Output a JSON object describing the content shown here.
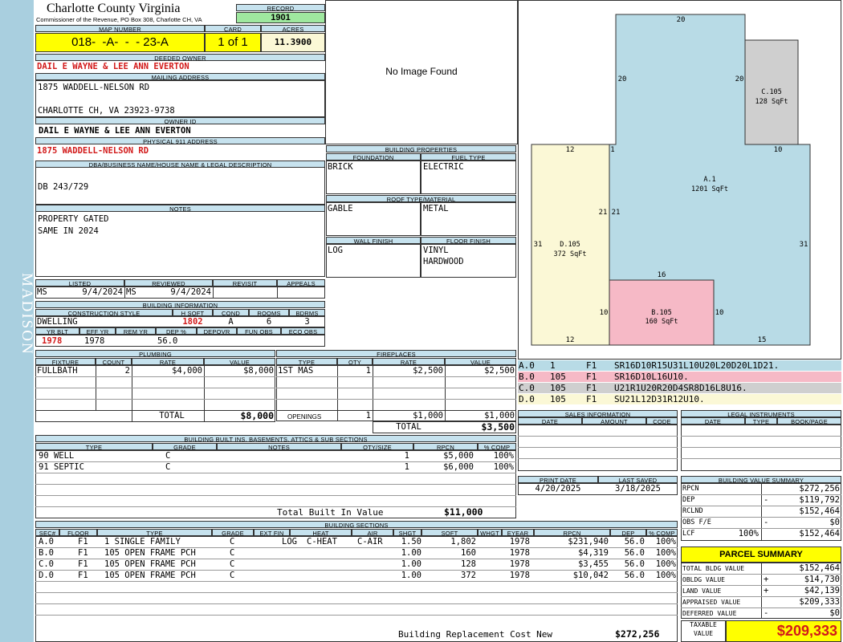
{
  "sidebar": {
    "label": "MADISON"
  },
  "header": {
    "county": "Charlotte County Virginia",
    "subtitle": "Commissioner of the Revenue, PO Box 308, Charlotte CH, VA",
    "record_label": "RECORD",
    "record": "1901"
  },
  "map": {
    "label": "MAP NUMBER",
    "value": "018-  -A-  -  - 23-A",
    "card_label": "CARD",
    "card": "1 of 1",
    "acres_label": "ACRES",
    "acres": "11.3900"
  },
  "owner": {
    "deeded_label": "DEEDED OWNER",
    "deeded": "DAIL E WAYNE & LEE ANN EVERTON",
    "mailing_label": "MAILING ADDRESS",
    "mail1": "1875 WADDELL-NELSON RD",
    "mail2": "CHARLOTTE CH, VA 23923-9738",
    "ownerid_label": "OWNER ID",
    "ownerid": "DAIL E WAYNE & LEE ANN EVERTON",
    "phys_label": "PHYSICAL 911 ADDRESS",
    "phys": "1875 WADDELL-NELSON RD"
  },
  "dba": {
    "label": "DBA/BUSINESS NAME/HOUSE NAME & LEGAL DESCRIPTION",
    "value": "DB 243/729"
  },
  "notes": {
    "label": "NOTES",
    "line1": "PROPERTY GATED",
    "line2": "SAME IN 2024"
  },
  "photo": {
    "text": "No Image Found"
  },
  "listed": {
    "listed_label": "LISTED",
    "reviewed_label": "REVIEWED",
    "revisit_label": "REVISIT",
    "appeals_label": "APPEALS",
    "listed_by": "MS",
    "listed_date": "9/4/2024",
    "reviewed_by": "MS",
    "reviewed_date": "9/4/2024"
  },
  "building_info": {
    "label": "BUILDING INFORMATION",
    "h_style": "CONSTRUCTION STYLE",
    "h_sqft": "H SQFT",
    "h_cond": "COND",
    "h_rooms": "ROOMS",
    "h_bdrms": "BDRMS",
    "style": "DWELLING",
    "sqft": "1802",
    "cond": "A",
    "rooms": "6",
    "bdrms": "3",
    "h_yrblt": "YR BLT",
    "h_effyr": "EFF YR",
    "h_remyr": "REM YR",
    "h_dep": "DEP %",
    "h_depovr": "DEPOVR",
    "h_funobs": "FUN OBS",
    "h_ecoobs": "ECO OBS",
    "yrblt": "1978",
    "effyr": "1978",
    "dep": "56.0"
  },
  "building_props": {
    "label": "BUILDING PROPERTIES",
    "foundation_label": "FOUNDATION",
    "fuel_label": "FUEL TYPE",
    "foundation": "BRICK",
    "fuel": "ELECTRIC",
    "roof_label": "ROOF TYPE/MATERIAL",
    "roof_type": "GABLE",
    "roof_mat": "METAL",
    "wall_label": "WALL FINISH",
    "floor_label": "FLOOR FINISH",
    "wall": "LOG",
    "floor1": "VINYL",
    "floor2": "HARDWOOD"
  },
  "plumbing": {
    "label": "PLUMBING",
    "h_fixture": "FIXTURE",
    "h_count": "COUNT",
    "h_rate": "RATE",
    "h_value": "VALUE",
    "rows": [
      {
        "fixture": "FULLBATH",
        "count": "2",
        "rate": "$4,000",
        "value": "$8,000"
      }
    ],
    "total_label": "TOTAL",
    "total": "$8,000"
  },
  "fireplaces": {
    "label": "FIREPLACES",
    "h_type": "TYPE",
    "h_qty": "QTY",
    "h_rate": "RATE",
    "h_value": "VALUE",
    "rows": [
      {
        "type": "1ST MAS",
        "qty": "1",
        "rate": "$2,500",
        "value": "$2,500"
      }
    ],
    "openings_label": "OPENINGS",
    "openings_qty": "1",
    "openings_rate": "$1,000",
    "openings_value": "$1,000",
    "total_label": "TOTAL",
    "total": "$3,500"
  },
  "sketch": {
    "lines": [
      {
        "code": "A.0",
        "n": "1",
        "f": "F1",
        "cmd": "SR16D10R15U31L10U20L20D20L1D21.",
        "color": "#b8dbe6"
      },
      {
        "code": "B.0",
        "n": "105",
        "f": "F1",
        "cmd": "SR16D10L16U10.",
        "color": "#f6b9c6"
      },
      {
        "code": "C.0",
        "n": "105",
        "f": "F1",
        "cmd": "U21R1U20R20D4SR8D16L8U16.",
        "color": "#cfcfcf"
      },
      {
        "code": "D.0",
        "n": "105",
        "f": "F1",
        "cmd": "SU21L12D31R12U10.",
        "color": "#fbf8d6"
      }
    ],
    "areas": {
      "a_label": "A.1",
      "a_sqft": "1201 SqFt",
      "b_label": "B.105",
      "b_sqft": "160 SqFt",
      "c_label": "C.105",
      "c_sqft": "128 SqFt",
      "d_label": "D.105",
      "d_sqft": "372 SqFt"
    },
    "dims": {
      "d20top": "20",
      "d20l": "20",
      "d20r": "20",
      "d12": "12",
      "d1": "1",
      "d10": "10",
      "d21a": "21",
      "d21b": "21",
      "d31l": "31",
      "d31r": "31",
      "d16": "16",
      "d10b": "10",
      "d10c": "10",
      "d12b": "12",
      "d15": "15"
    }
  },
  "sales": {
    "label": "SALES INFORMATION",
    "h_date": "DATE",
    "h_amount": "AMOUNT",
    "h_code": "CODE"
  },
  "legal": {
    "label": "LEGAL INSTRUMENTS",
    "h_date": "DATE",
    "h_type": "TYPE",
    "h_book": "BOOK/PAGE"
  },
  "dates": {
    "print_label": "PRINT DATE",
    "saved_label": "LAST SAVED",
    "print": "4/20/2025",
    "saved": "3/18/2025"
  },
  "builtins": {
    "label": "BUILDING BUILT INS, BASEMENTS, ATTICS & SUB SECTIONS",
    "h_type": "TYPE",
    "h_grade": "GRADE",
    "h_notes": "NOTES",
    "h_qty": "QTY/SIZE",
    "h_rpcn": "RPCN",
    "h_comp": "% COMP",
    "rows": [
      {
        "type": "90 WELL",
        "grade": "C",
        "qty": "1",
        "rpcn": "$5,000",
        "comp": "100%"
      },
      {
        "type": "91 SEPTIC",
        "grade": "C",
        "qty": "1",
        "rpcn": "$6,000",
        "comp": "100%"
      }
    ],
    "total_label": "Total Built In Value",
    "total": "$11,000"
  },
  "sections": {
    "label": "BUILDING SECTIONS",
    "h": {
      "sec": "SEC#",
      "floor": "FLOOR",
      "type": "TYPE",
      "grade": "GRADE",
      "extfin": "EXT FIN",
      "heat": "HEAT",
      "air": "AIR",
      "shgt": "SHGT",
      "sqft": "SQFT",
      "whgt": "WHGT",
      "eyear": "EYEAR",
      "rpcn": "RPCN",
      "dep": "DEP",
      "comp": "% COMP"
    },
    "rows": [
      {
        "sec": "A.0",
        "floor": "F1",
        "type": "1 SINGLE FAMILY",
        "grade": "C",
        "extfin": "LOG",
        "heat": "C-HEAT",
        "air": "C-AIR",
        "shgt": "1.50",
        "sqft": "1,802",
        "eyear": "1978",
        "rpcn": "$231,940",
        "dep": "56.0",
        "comp": "100%"
      },
      {
        "sec": "B.0",
        "floor": "F1",
        "type": "105 OPEN FRAME PCH",
        "grade": "C",
        "extfin": "",
        "heat": "",
        "air": "",
        "shgt": "1.00",
        "sqft": "160",
        "eyear": "1978",
        "rpcn": "$4,319",
        "dep": "56.0",
        "comp": "100%"
      },
      {
        "sec": "C.0",
        "floor": "F1",
        "type": "105 OPEN FRAME PCH",
        "grade": "C",
        "extfin": "",
        "heat": "",
        "air": "",
        "shgt": "1.00",
        "sqft": "128",
        "eyear": "1978",
        "rpcn": "$3,455",
        "dep": "56.0",
        "comp": "100%"
      },
      {
        "sec": "D.0",
        "floor": "F1",
        "type": "105 OPEN FRAME PCH",
        "grade": "C",
        "extfin": "",
        "heat": "",
        "air": "",
        "shgt": "1.00",
        "sqft": "372",
        "eyear": "1978",
        "rpcn": "$10,042",
        "dep": "56.0",
        "comp": "100%"
      }
    ],
    "brcn_label": "Building Replacement Cost New",
    "brcn": "$272,256"
  },
  "bvs": {
    "label": "BUILDING VALUE SUMMARY",
    "rpcn_label": "RPCN",
    "rpcn": "$272,256",
    "dep_label": "DEP",
    "dep_sign": "-",
    "dep": "$119,792",
    "rclnd_label": "RCLND",
    "rclnd": "$152,464",
    "obs_label": "OBS F/E",
    "obs_sign": "-",
    "obs": "$0",
    "lcf_label": "LCF",
    "lcf_pct": "100%",
    "lcf": "$152,464"
  },
  "parcel": {
    "label": "PARCEL SUMMARY",
    "bldg_label": "TOTAL BLDG VALUE",
    "bldg": "$152,464",
    "obldg_label": "OBLDG VALUE",
    "obldg_sign": "+",
    "obldg": "$14,730",
    "land_label": "LAND VALUE",
    "land_sign": "+",
    "land": "$42,139",
    "appr_label": "APPRAISED VALUE",
    "appr": "$209,333",
    "def_label": "DEFERRED VALUE",
    "def_sign": "-",
    "def": "$0",
    "tax_label1": "TAXABLE",
    "tax_label2": "VALUE",
    "tax": "$209,333"
  },
  "colors": {
    "sidebar": "#a9cfdf",
    "header": "#c6e2ee",
    "yellow": "#ffff00",
    "record_green": "#9fe89f",
    "red": "#d21a1a",
    "a_area": "#b8dbe6",
    "b_area": "#f6b9c6",
    "c_area": "#cfcfcf",
    "d_area": "#fbf8d6"
  }
}
